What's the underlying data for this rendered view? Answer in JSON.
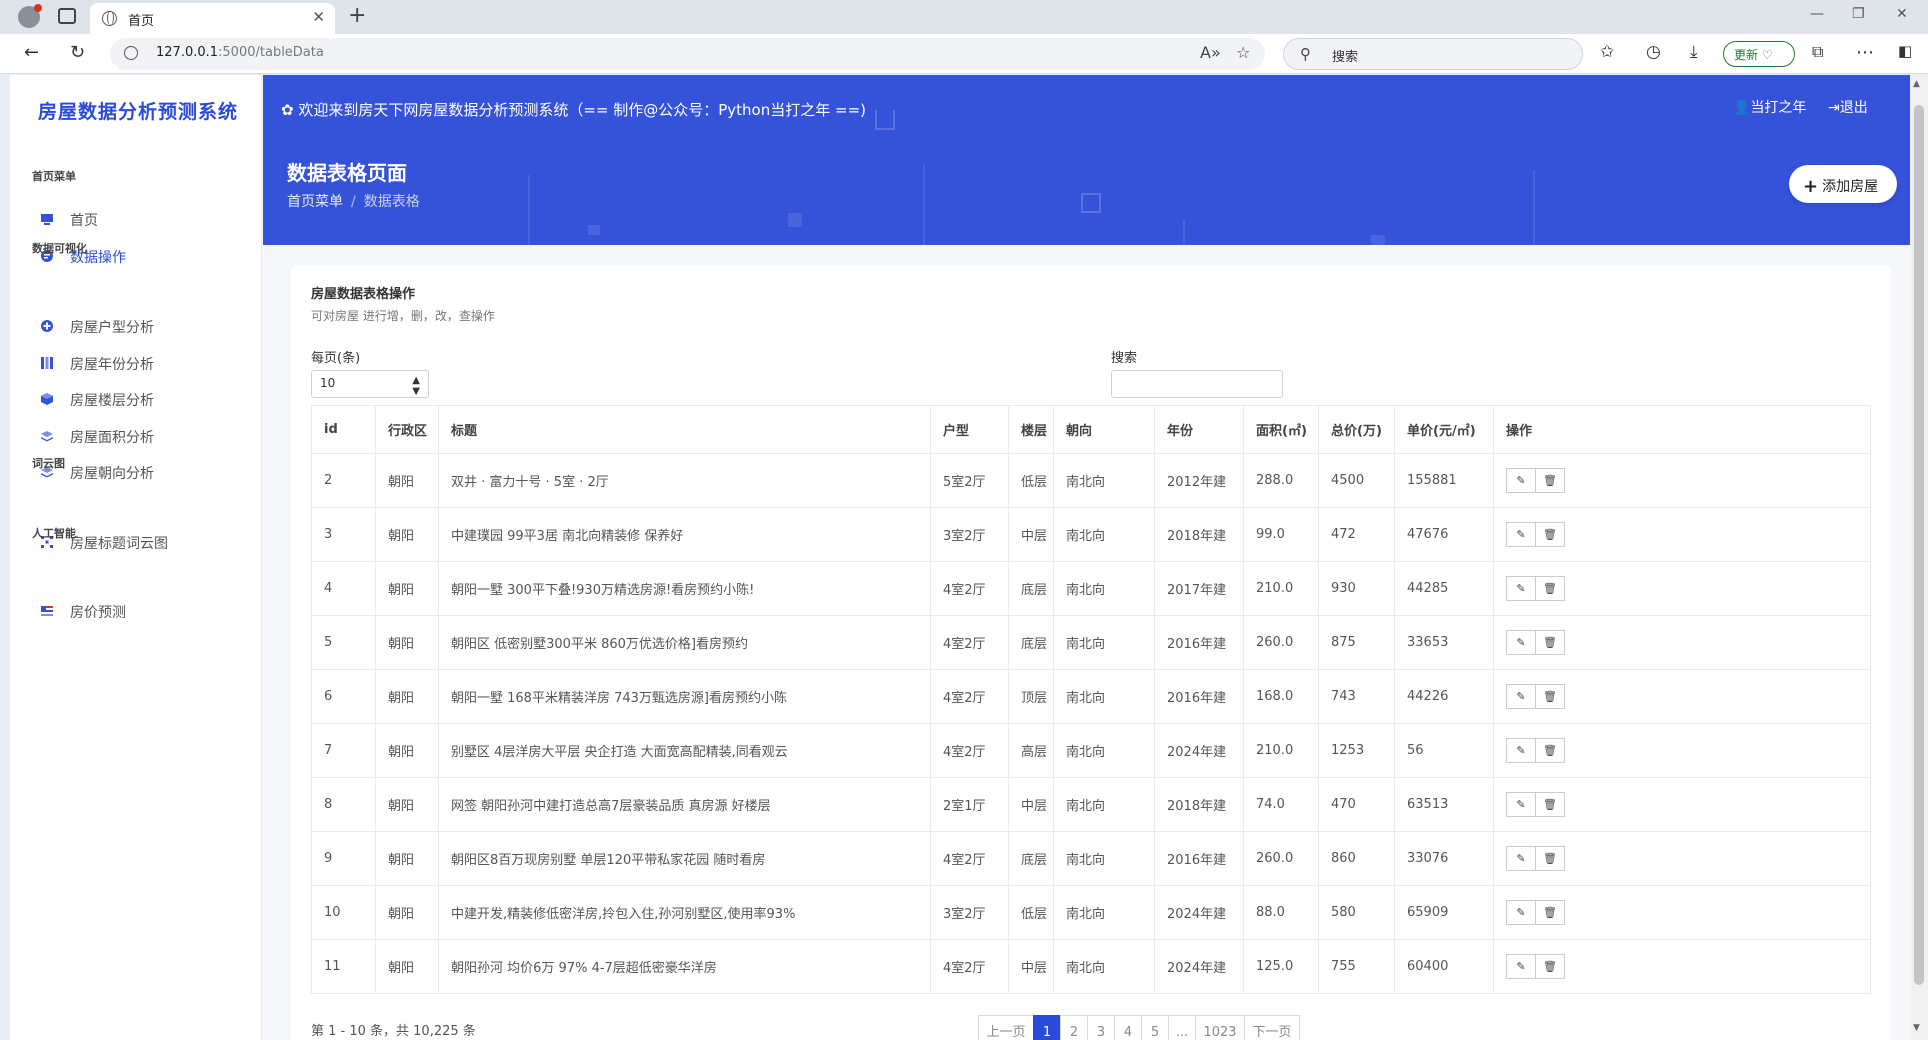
{
  "browser": {
    "tab_title": "首页",
    "url_host": "127.0.0.1",
    "url_rest": ":5000/tableData",
    "search_placeholder": "搜索",
    "update_label": "更新"
  },
  "sidebar": {
    "logo": "房屋数据分析预测系统",
    "sections": [
      {
        "title": "首页菜单",
        "items": [
          {
            "label": "首页",
            "icon": "monitor-icon"
          },
          {
            "label": "数据操作",
            "icon": "chat-icon",
            "active": true
          }
        ]
      },
      {
        "title": "数据可视化",
        "items": [
          {
            "label": "房屋户型分析",
            "icon": "plus-circle-icon"
          },
          {
            "label": "房屋年份分析",
            "icon": "columns-icon"
          },
          {
            "label": "房屋楼层分析",
            "icon": "cube-icon"
          },
          {
            "label": "房屋面积分析",
            "icon": "layers-icon"
          },
          {
            "label": "房屋朝向分析",
            "icon": "layers-icon"
          }
        ]
      },
      {
        "title": "词云图",
        "items": [
          {
            "label": "房屋标题词云图",
            "icon": "grid-dots-icon"
          }
        ]
      },
      {
        "title": "人工智能",
        "items": [
          {
            "label": "房价预测",
            "icon": "flag-icon"
          }
        ]
      }
    ]
  },
  "header": {
    "welcome": "✿ 欢迎来到房天下网房屋数据分析预测系统（== 制作@公众号：Python当打之年 ==)",
    "user": "当打之年",
    "logout": "退出",
    "page_title": "数据表格页面",
    "breadcrumb": [
      "首页菜单",
      "数据表格"
    ],
    "add_button": "添加房屋"
  },
  "card": {
    "title": "房屋数据表格操作",
    "subtitle": "可对房屋 进行增，删，改，查操作",
    "per_page_label": "每页(条)",
    "per_page_value": "10",
    "search_label": "搜索",
    "search_value": ""
  },
  "table": {
    "headers": [
      "id",
      "行政区",
      "标题",
      "户型",
      "楼层",
      "朝向",
      "年份",
      "面积(㎡)",
      "总价(万)",
      "单价(元/㎡)",
      "操作"
    ],
    "rows": [
      [
        "2",
        "朝阳",
        "双井 · 富力十号 · 5室 · 2厅",
        "5室2厅",
        "低层",
        "南北向",
        "2012年建",
        "288.0",
        "4500",
        "155881"
      ],
      [
        "3",
        "朝阳",
        "中建璞园 99平3居 南北向精装修 保养好",
        "3室2厅",
        "中层",
        "南北向",
        "2018年建",
        "99.0",
        "472",
        "47676"
      ],
      [
        "4",
        "朝阳",
        "朝阳一墅 300平下叠!930万精选房源!看房预约小陈!",
        "4室2厅",
        "底层",
        "南北向",
        "2017年建",
        "210.0",
        "930",
        "44285"
      ],
      [
        "5",
        "朝阳",
        "朝阳区 低密别墅300平米 860万优选价格]看房预约",
        "4室2厅",
        "底层",
        "南北向",
        "2016年建",
        "260.0",
        "875",
        "33653"
      ],
      [
        "6",
        "朝阳",
        "朝阳一墅 168平米精装洋房 743万甄选房源]看房预约小陈",
        "4室2厅",
        "顶层",
        "南北向",
        "2016年建",
        "168.0",
        "743",
        "44226"
      ],
      [
        "7",
        "朝阳",
        "别墅区 4层洋房大平层 央企打造 大面宽高配精装,同看观云",
        "4室2厅",
        "高层",
        "南北向",
        "2024年建",
        "210.0",
        "1253",
        "56"
      ],
      [
        "8",
        "朝阳",
        "网签 朝阳孙河中建打造总高7层豪装品质 真房源 好楼层",
        "2室1厅",
        "中层",
        "南北向",
        "2018年建",
        "74.0",
        "470",
        "63513"
      ],
      [
        "9",
        "朝阳",
        "朝阳区8百万现房别墅 单层120平带私家花园 随时看房",
        "4室2厅",
        "底层",
        "南北向",
        "2016年建",
        "260.0",
        "860",
        "33076"
      ],
      [
        "10",
        "朝阳",
        "中建开发,精装修低密洋房,拎包入住,孙河别墅区,使用率93%",
        "3室2厅",
        "低层",
        "南北向",
        "2024年建",
        "88.0",
        "580",
        "65909"
      ],
      [
        "11",
        "朝阳",
        "朝阳孙河 均价6万 97% 4-7层超低密豪华洋房",
        "4室2厅",
        "中层",
        "南北向",
        "2024年建",
        "125.0",
        "755",
        "60400"
      ]
    ]
  },
  "pagination": {
    "summary": "第 1 - 10 条，共 10,225 条",
    "prev": "上一页",
    "pages": [
      "1",
      "2",
      "3",
      "4",
      "5",
      "...",
      "1023"
    ],
    "current": "1",
    "next": "下一页"
  },
  "colors": {
    "accent": "#3553d9",
    "brand": "#2a4ad9"
  }
}
